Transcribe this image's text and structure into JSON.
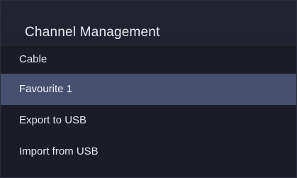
{
  "panel": {
    "title": "Channel Management"
  },
  "menu": {
    "items": [
      {
        "label": "Cable",
        "selected": false
      },
      {
        "label": "Favourite 1",
        "selected": true
      },
      {
        "label": "Export to USB",
        "selected": false
      },
      {
        "label": "Import from USB",
        "selected": false
      }
    ]
  },
  "colors": {
    "panel_background": "#1b1c26",
    "header_background": "#212333",
    "selected_highlight": "#44506e",
    "text": "#e6e8ee"
  }
}
